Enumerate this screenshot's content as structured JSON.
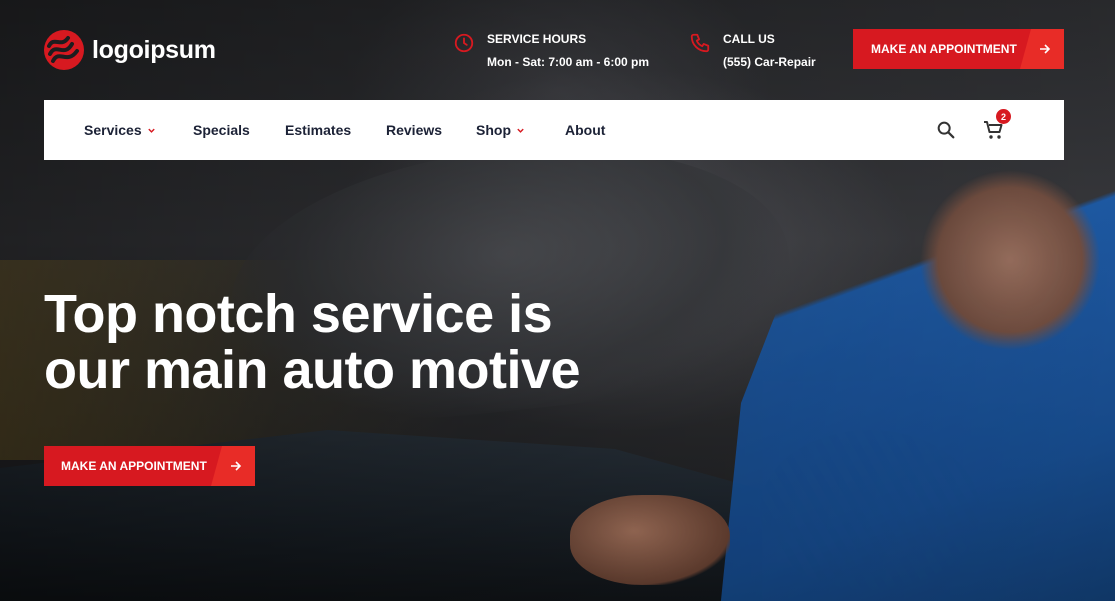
{
  "brand": {
    "name": "logoipsum",
    "accent": "#d71920"
  },
  "header": {
    "hours": {
      "label": "SERVICE HOURS",
      "value": "Mon - Sat: 7:00 am - 6:00 pm",
      "icon": "clock-icon"
    },
    "call": {
      "label": "CALL US",
      "value": "(555) Car-Repair",
      "icon": "phone-icon"
    },
    "cta": {
      "label": "MAKE AN APPOINTMENT",
      "icon": "arrow-right-icon"
    }
  },
  "nav": {
    "items": [
      {
        "label": "Services",
        "has_dropdown": true
      },
      {
        "label": "Specials",
        "has_dropdown": false
      },
      {
        "label": "Estimates",
        "has_dropdown": false
      },
      {
        "label": "Reviews",
        "has_dropdown": false
      },
      {
        "label": "Shop",
        "has_dropdown": true
      },
      {
        "label": "About",
        "has_dropdown": false
      }
    ],
    "search_icon": "search-icon",
    "cart": {
      "icon": "cart-icon",
      "count": "2"
    }
  },
  "hero": {
    "title_line1": "Top notch service is",
    "title_line2": "our main auto motive",
    "cta": {
      "label": "MAKE AN APPOINTMENT",
      "icon": "arrow-right-icon"
    }
  }
}
